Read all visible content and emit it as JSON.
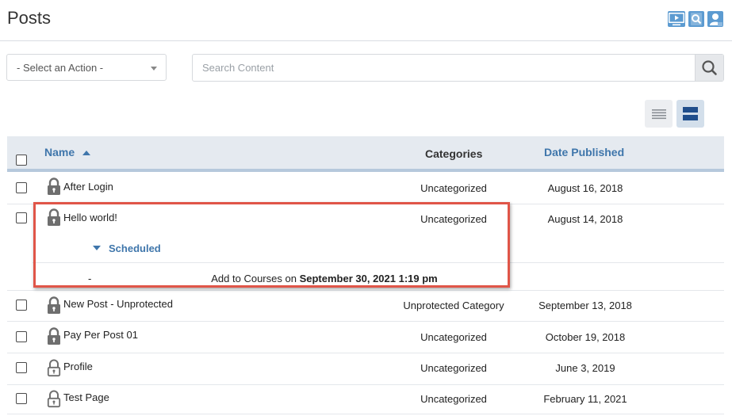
{
  "header": {
    "title": "Posts",
    "icons": [
      "video-icon",
      "search-doc-icon",
      "user-icon"
    ]
  },
  "toolbar": {
    "action_select": "- Select an Action -",
    "search_placeholder": "Search Content",
    "search_value": ""
  },
  "table": {
    "columns": {
      "name": "Name",
      "categories": "Categories",
      "date": "Date Published"
    },
    "rows": [
      {
        "title": "After Login",
        "category": "Uncategorized",
        "date": "August 16, 2018",
        "lock": "locked"
      },
      {
        "title": "Hello world!",
        "category": "Uncategorized",
        "date": "August 14, 2018",
        "lock": "locked",
        "scheduled": {
          "label": "Scheduled",
          "dash": "-",
          "action": "Add to Courses on",
          "when": "September 30, 2021 1:19 pm"
        }
      },
      {
        "title": "New Post - Unprotected",
        "category": "Unprotected Category",
        "date": "September 13, 2018",
        "lock": "locked"
      },
      {
        "title": "Pay Per Post 01",
        "category": "Uncategorized",
        "date": "October 19, 2018",
        "lock": "locked"
      },
      {
        "title": "Profile",
        "category": "Uncategorized",
        "date": "June 3, 2019",
        "lock": "unlocked"
      },
      {
        "title": "Test Page",
        "category": "Uncategorized",
        "date": "February 11, 2021",
        "lock": "unlocked"
      }
    ]
  },
  "colors": {
    "accent": "#3f76ab",
    "highlight": "#e05548",
    "icon_blue": "#5c9bd1",
    "lock": "#6e6e6e"
  }
}
